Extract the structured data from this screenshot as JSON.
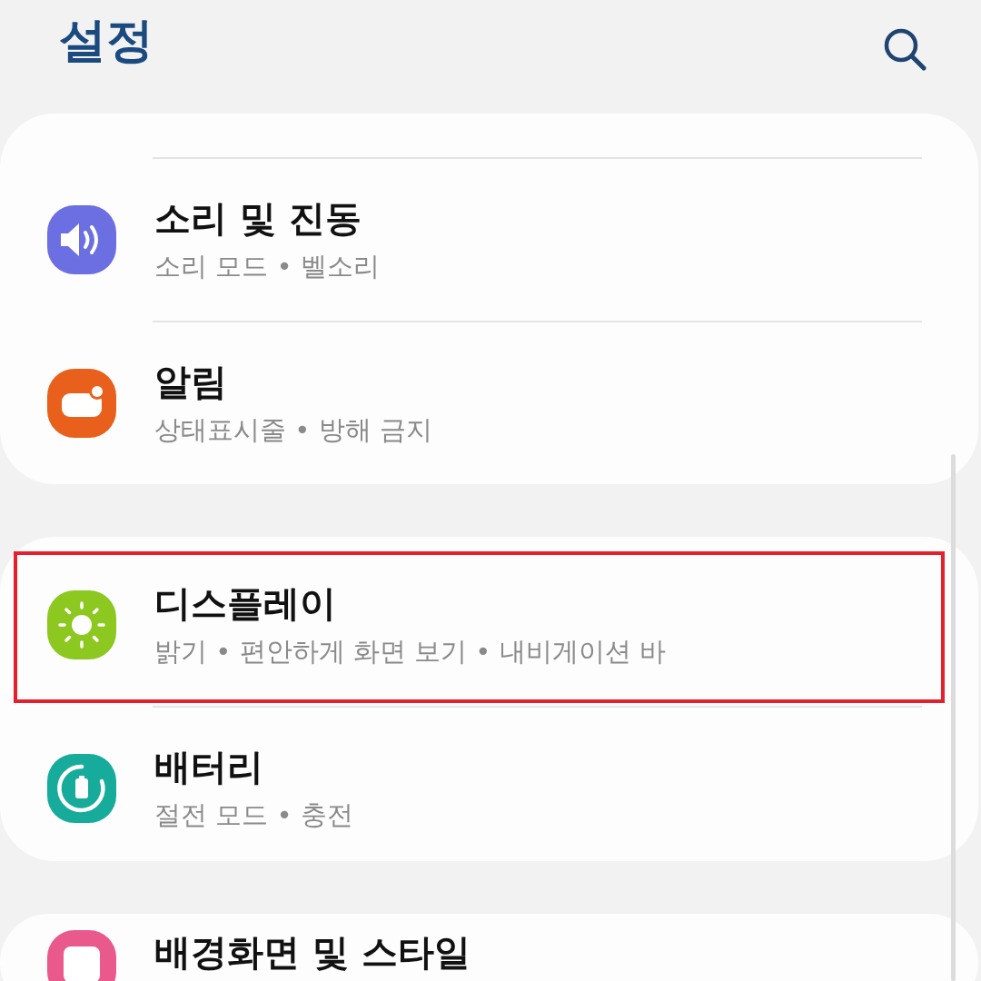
{
  "header": {
    "title": "설정"
  },
  "groups": [
    {
      "items": [
        {
          "kind": "sound",
          "title": "소리 및 진동",
          "subtitle": "소리 모드 • 벨소리",
          "color": "#6b6fe2",
          "highlighted": false
        },
        {
          "kind": "notification",
          "title": "알림",
          "subtitle": "상태표시줄 • 방해 금지",
          "color": "#e8601c",
          "highlighted": false
        }
      ]
    },
    {
      "items": [
        {
          "kind": "display",
          "title": "디스플레이",
          "subtitle": "밝기 • 편안하게 화면 보기 • 내비게이션 바",
          "color": "#8cc820",
          "highlighted": true
        },
        {
          "kind": "battery",
          "title": "배터리",
          "subtitle": "절전 모드 • 충전",
          "color": "#17ab9c",
          "highlighted": false
        }
      ]
    },
    {
      "items": [
        {
          "kind": "wallpaper",
          "title": "배경화면 및 스타일",
          "color": "#e9598c",
          "highlighted": false
        }
      ]
    }
  ]
}
